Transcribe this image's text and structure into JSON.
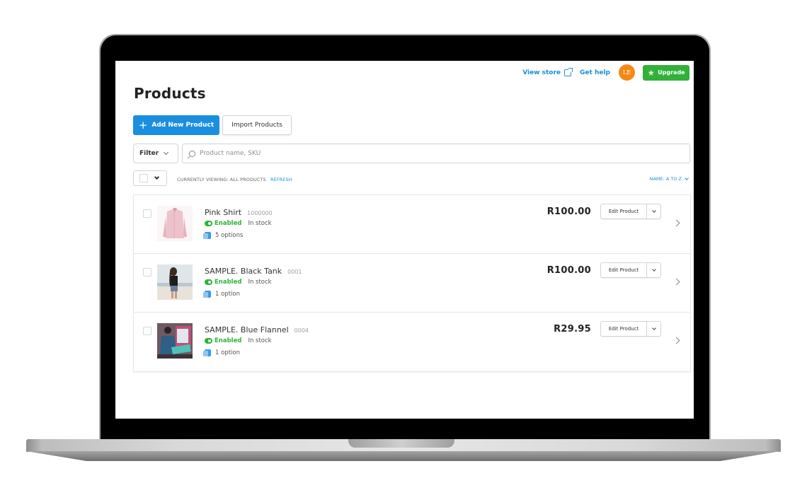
{
  "header": {
    "view_store": "View store",
    "get_help": "Get help",
    "avatar_initials": "LE",
    "upgrade": "Upgrade"
  },
  "page": {
    "title": "Products",
    "add_button": "Add New Product",
    "import_button": "Import Products"
  },
  "filters": {
    "filter_label": "Filter",
    "search_placeholder": "Product name, SKU",
    "search_value": ""
  },
  "list_meta": {
    "viewing_text": "CURRENTLY VIEWING: ALL PRODUCTS",
    "refresh": "REFRESH",
    "sort": "NAME: A TO Z"
  },
  "products": [
    {
      "name": "Pink Shirt",
      "sku": "1000000",
      "status": "Enabled",
      "stock": "In stock",
      "options": "5 options",
      "price": "R100.00",
      "edit_label": "Edit Product"
    },
    {
      "name": "SAMPLE. Black Tank",
      "sku": "0001",
      "status": "Enabled",
      "stock": "In stock",
      "options": "1 option",
      "price": "R100.00",
      "edit_label": "Edit Product"
    },
    {
      "name": "SAMPLE. Blue Flannel",
      "sku": "0004",
      "status": "Enabled",
      "stock": "In stock",
      "options": "1 option",
      "price": "R29.95",
      "edit_label": "Edit Product"
    }
  ],
  "colors": {
    "primary": "#1a8fe0",
    "success": "#31b13a",
    "avatar": "#f38a17"
  }
}
